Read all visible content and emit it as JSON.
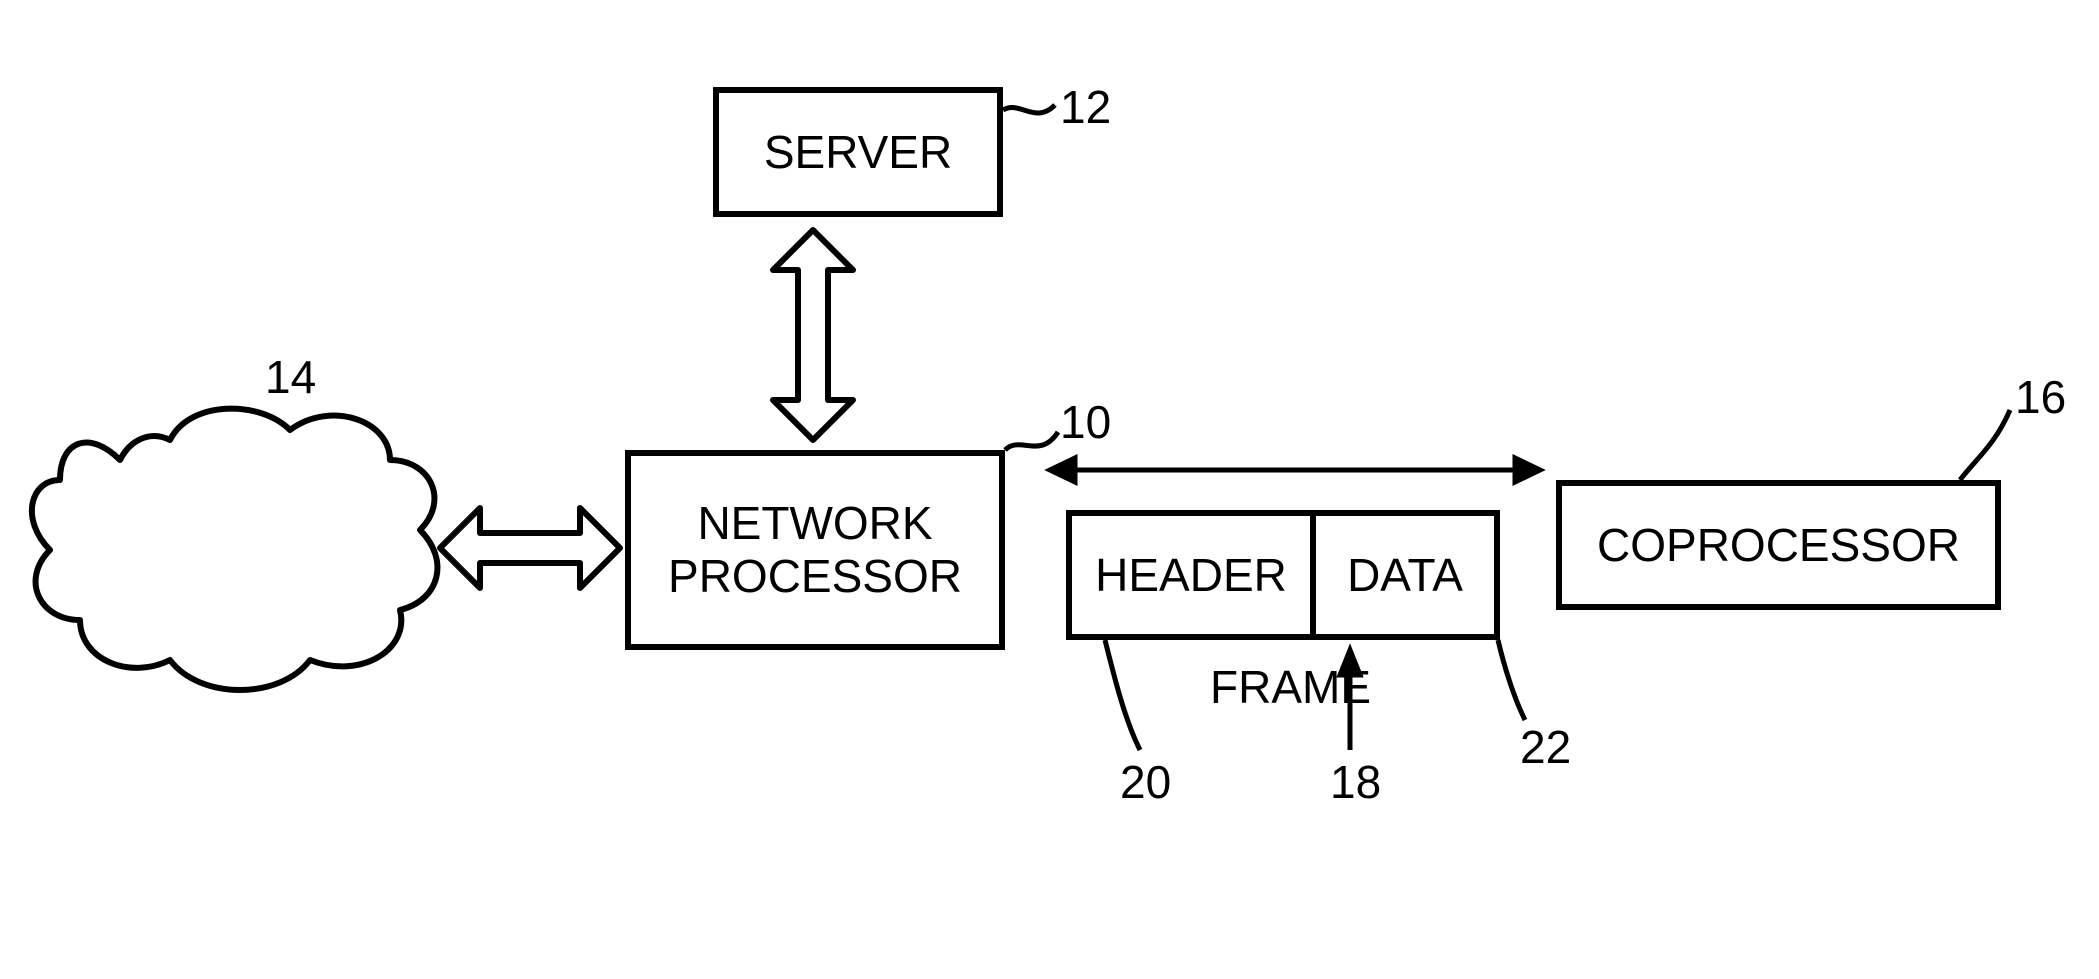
{
  "blocks": {
    "server": {
      "label": "SERVER",
      "ref": "12"
    },
    "network": {
      "label": "NETWORK",
      "ref": "14"
    },
    "network_processor": {
      "label": "NETWORK\nPROCESSOR",
      "ref": "10"
    },
    "header": {
      "label": "HEADER",
      "ref": "20"
    },
    "data": {
      "label": "DATA",
      "ref": "22"
    },
    "frame": {
      "label": "FRAME",
      "ref": "18"
    },
    "coprocessor": {
      "label": "COPROCESSOR",
      "ref": "16"
    }
  }
}
